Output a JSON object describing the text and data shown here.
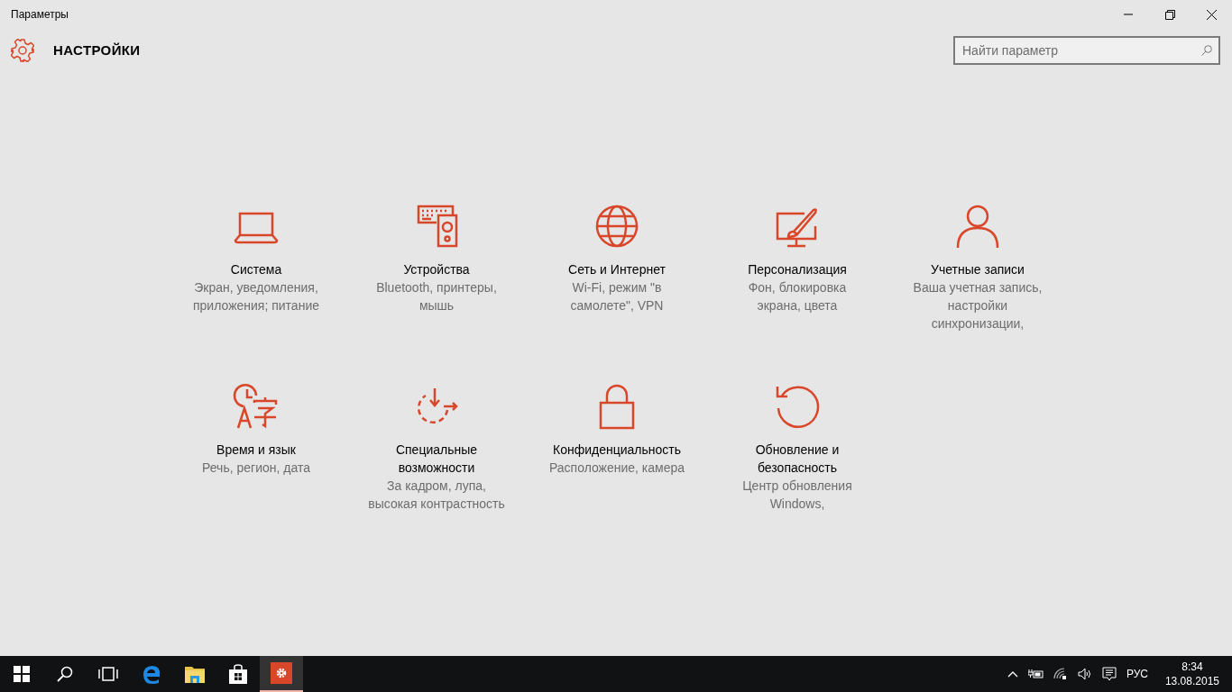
{
  "window": {
    "title": "Параметры"
  },
  "header": {
    "title": "НАСТРОЙКИ"
  },
  "search": {
    "placeholder": "Найти параметр"
  },
  "categories": [
    {
      "title": "Система",
      "description": "Экран, уведомления, приложения; питание"
    },
    {
      "title": "Устройства",
      "description": "Bluetooth, принтеры, мышь"
    },
    {
      "title": "Сеть и Интернет",
      "description": "Wi-Fi, режим \"в самолете\", VPN"
    },
    {
      "title": "Персонализация",
      "description": "Фон, блокировка экрана, цвета"
    },
    {
      "title": "Учетные записи",
      "description": "Ваша учетная запись, настройки синхронизации,"
    },
    {
      "title": "Время и язык",
      "description": "Речь, регион, дата"
    },
    {
      "title": "Специальные возможности",
      "description": "За кадром, лупа, высокая контрастность"
    },
    {
      "title": "Конфиденциальность",
      "description": "Расположение, камера"
    },
    {
      "title": "Обновление и безопасность",
      "description": "Центр обновления Windows,"
    }
  ],
  "taskbar": {
    "apps": [
      {
        "kind": "start",
        "selected": false
      },
      {
        "kind": "search",
        "selected": false
      },
      {
        "kind": "taskview",
        "selected": false
      },
      {
        "kind": "browser",
        "selected": false
      },
      {
        "kind": "explorer",
        "selected": false
      },
      {
        "kind": "store",
        "selected": false
      },
      {
        "kind": "settings",
        "selected": true
      }
    ],
    "language": "РУС",
    "time": "8:34",
    "date": "13.08.2015"
  }
}
